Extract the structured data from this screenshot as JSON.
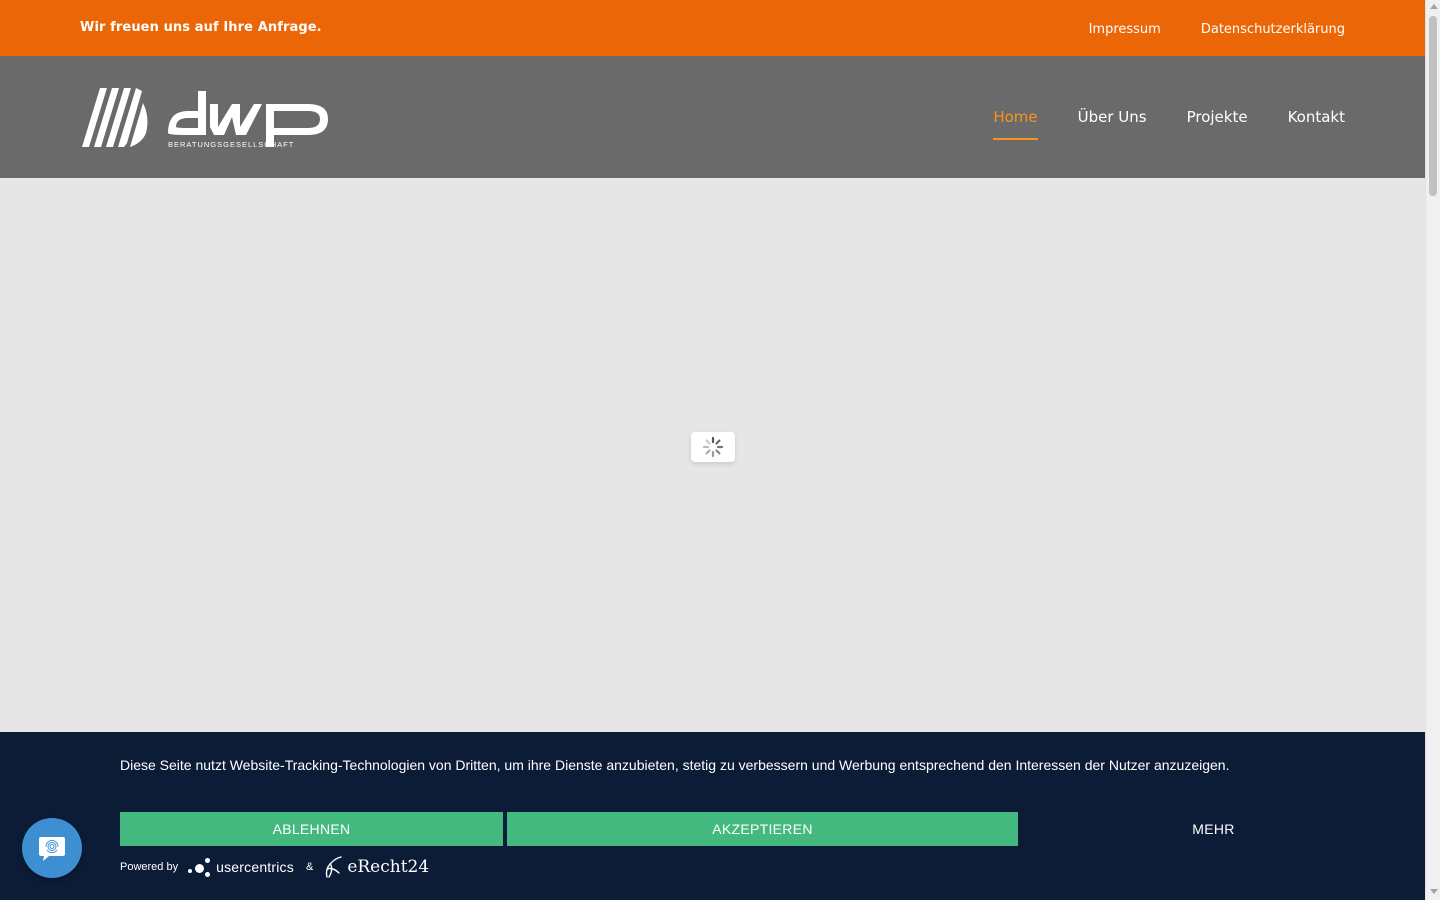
{
  "topbar": {
    "tagline": "Wir freuen uns auf Ihre Anfrage.",
    "links": [
      "Impressum",
      "Datenschutzerklärung"
    ]
  },
  "header": {
    "logo_text": "dwp",
    "logo_subtext": "BERATUNGSGESELLSCHAFT",
    "nav": [
      "Home",
      "Über Uns",
      "Projekte",
      "Kontakt"
    ],
    "active_nav": "Home"
  },
  "main": {
    "loader_icon": "spinner-icon"
  },
  "cookie_banner": {
    "message": "Diese Seite nutzt Website-Tracking-Technologien von Dritten, um ihre Dienste anzubieten, stetig zu verbessern und Werbung entsprechend den Interessen der Nutzer anzuzeigen.",
    "decline_label": "ABLEHNEN",
    "accept_label": "AKZEPTIEREN",
    "more_label": "MEHR",
    "powered_by": "Powered by",
    "provider_1": "usercentrics",
    "ampersand": "&",
    "provider_2": "eRecht24"
  },
  "chat_widget": {
    "icon": "fingerprint-chat-icon"
  },
  "colors": {
    "topbar": "#ea6607",
    "header": "#6a6a6a",
    "accent": "#f7941d",
    "banner": "#0c1c37",
    "button": "#43b97f",
    "chat": "#3d8fd1"
  }
}
